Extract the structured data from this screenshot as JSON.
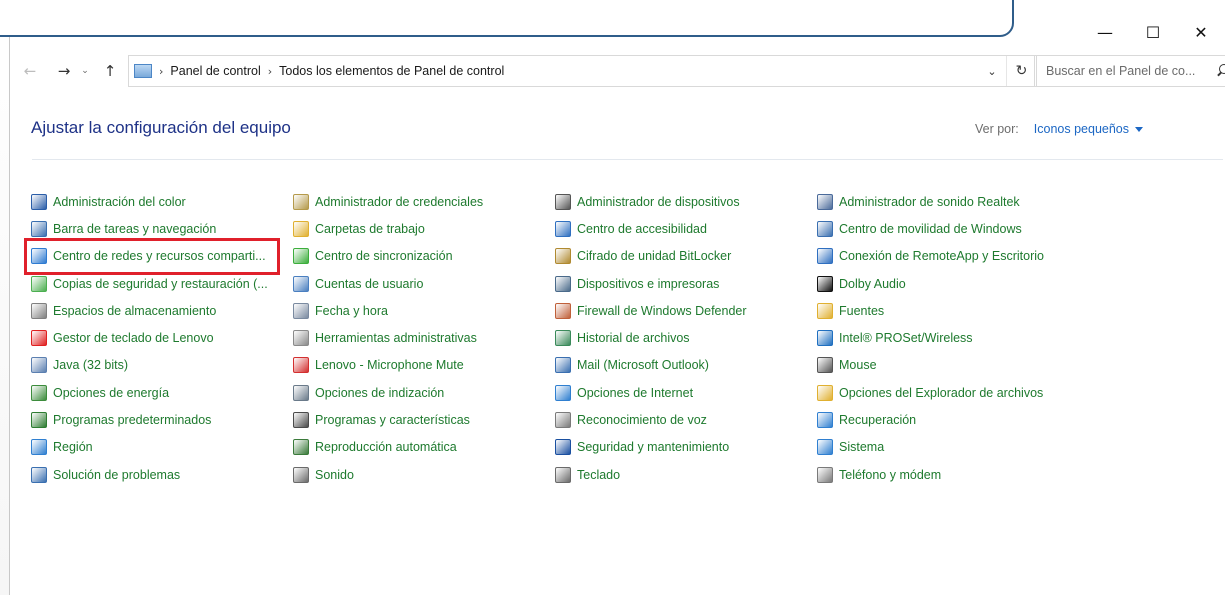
{
  "window": {
    "controls": {
      "minimize": "—",
      "maximize": "☐",
      "close": "✕"
    }
  },
  "address": {
    "breadcrumb": [
      "Panel de control",
      "Todos los elementos de Panel de control"
    ],
    "search_placeholder": "Buscar en el Panel de co..."
  },
  "header": {
    "title": "Ajustar la configuración del equipo",
    "view_by_label": "Ver por:",
    "view_by_value": "Iconos pequeños"
  },
  "items": {
    "col1": [
      {
        "label": "Administración del color",
        "icon": "color-management-icon",
        "color": "#2a5da8"
      },
      {
        "label": "Barra de tareas y navegación",
        "icon": "taskbar-icon",
        "color": "#3a6fb0"
      },
      {
        "label": "Centro de redes y recursos comparti...",
        "icon": "network-center-icon",
        "color": "#2e7bd1"
      },
      {
        "label": "Copias de seguridad y restauración (...",
        "icon": "backup-icon",
        "color": "#4caf50"
      },
      {
        "label": "Espacios de almacenamiento",
        "icon": "storage-spaces-icon",
        "color": "#808080"
      },
      {
        "label": "Gestor de teclado de Lenovo",
        "icon": "lenovo-keyboard-icon",
        "color": "#e02020"
      },
      {
        "label": "Java (32 bits)",
        "icon": "java-icon",
        "color": "#5b7fb0"
      },
      {
        "label": "Opciones de energía",
        "icon": "power-options-icon",
        "color": "#3c8c3c"
      },
      {
        "label": "Programas predeterminados",
        "icon": "default-programs-icon",
        "color": "#2e7d32"
      },
      {
        "label": "Región",
        "icon": "region-icon",
        "color": "#2f7fd0"
      },
      {
        "label": "Solución de problemas",
        "icon": "troubleshooting-icon",
        "color": "#3a6fb0"
      }
    ],
    "col2": [
      {
        "label": "Administrador de credenciales",
        "icon": "credential-manager-icon",
        "color": "#b59a4a"
      },
      {
        "label": "Carpetas de trabajo",
        "icon": "work-folders-icon",
        "color": "#e0b030"
      },
      {
        "label": "Centro de sincronización",
        "icon": "sync-center-icon",
        "color": "#3cae3c"
      },
      {
        "label": "Cuentas de usuario",
        "icon": "user-accounts-icon",
        "color": "#4a7fc0"
      },
      {
        "label": "Fecha y hora",
        "icon": "date-time-icon",
        "color": "#7a8aa0"
      },
      {
        "label": "Herramientas administrativas",
        "icon": "admin-tools-icon",
        "color": "#8a8a8a"
      },
      {
        "label": "Lenovo - Microphone Mute",
        "icon": "microphone-mute-icon",
        "color": "#d32f2f"
      },
      {
        "label": "Opciones de indización",
        "icon": "indexing-options-icon",
        "color": "#6a7a8a"
      },
      {
        "label": "Programas y características",
        "icon": "programs-features-icon",
        "color": "#4a4a4a"
      },
      {
        "label": "Reproducción automática",
        "icon": "autoplay-icon",
        "color": "#3a7a3a"
      },
      {
        "label": "Sonido",
        "icon": "sound-icon",
        "color": "#6a6a6a"
      }
    ],
    "col3": [
      {
        "label": "Administrador de dispositivos",
        "icon": "device-manager-icon",
        "color": "#555555"
      },
      {
        "label": "Centro de accesibilidad",
        "icon": "accessibility-icon",
        "color": "#2f6fc0"
      },
      {
        "label": "Cifrado de unidad BitLocker",
        "icon": "bitlocker-icon",
        "color": "#b08a30"
      },
      {
        "label": "Dispositivos e impresoras",
        "icon": "devices-printers-icon",
        "color": "#4a6a8a"
      },
      {
        "label": "Firewall de Windows Defender",
        "icon": "firewall-icon",
        "color": "#c0603a"
      },
      {
        "label": "Historial de archivos",
        "icon": "file-history-icon",
        "color": "#3a8a5a"
      },
      {
        "label": "Mail (Microsoft Outlook)",
        "icon": "mail-icon",
        "color": "#3a6fb0"
      },
      {
        "label": "Opciones de Internet",
        "icon": "internet-options-icon",
        "color": "#2f7fd0"
      },
      {
        "label": "Reconocimiento de voz",
        "icon": "speech-recognition-icon",
        "color": "#7a7a7a"
      },
      {
        "label": "Seguridad y mantenimiento",
        "icon": "security-maintenance-icon",
        "color": "#1a4fa0"
      },
      {
        "label": "Teclado",
        "icon": "keyboard-icon",
        "color": "#6a6a6a"
      }
    ],
    "col4": [
      {
        "label": "Administrador de sonido Realtek",
        "icon": "realtek-audio-icon",
        "color": "#4a6a9a"
      },
      {
        "label": "Centro de movilidad de Windows",
        "icon": "mobility-center-icon",
        "color": "#3a6fb0"
      },
      {
        "label": "Conexión de RemoteApp y Escritorio",
        "icon": "remoteapp-icon",
        "color": "#2f6fc0"
      },
      {
        "label": "Dolby Audio",
        "icon": "dolby-icon",
        "color": "#111111"
      },
      {
        "label": "Fuentes",
        "icon": "fonts-icon",
        "color": "#e0b030"
      },
      {
        "label": "Intel® PROSet/Wireless",
        "icon": "intel-wireless-icon",
        "color": "#1f6fc0"
      },
      {
        "label": "Mouse",
        "icon": "mouse-icon",
        "color": "#555555"
      },
      {
        "label": "Opciones del Explorador de archivos",
        "icon": "file-explorer-options-icon",
        "color": "#e0b030"
      },
      {
        "label": "Recuperación",
        "icon": "recovery-icon",
        "color": "#2f7fd0"
      },
      {
        "label": "Sistema",
        "icon": "system-icon",
        "color": "#2f7fd0"
      },
      {
        "label": "Teléfono y módem",
        "icon": "phone-modem-icon",
        "color": "#7a7a7a"
      }
    ]
  },
  "highlight": {
    "color": "#e0202b"
  }
}
